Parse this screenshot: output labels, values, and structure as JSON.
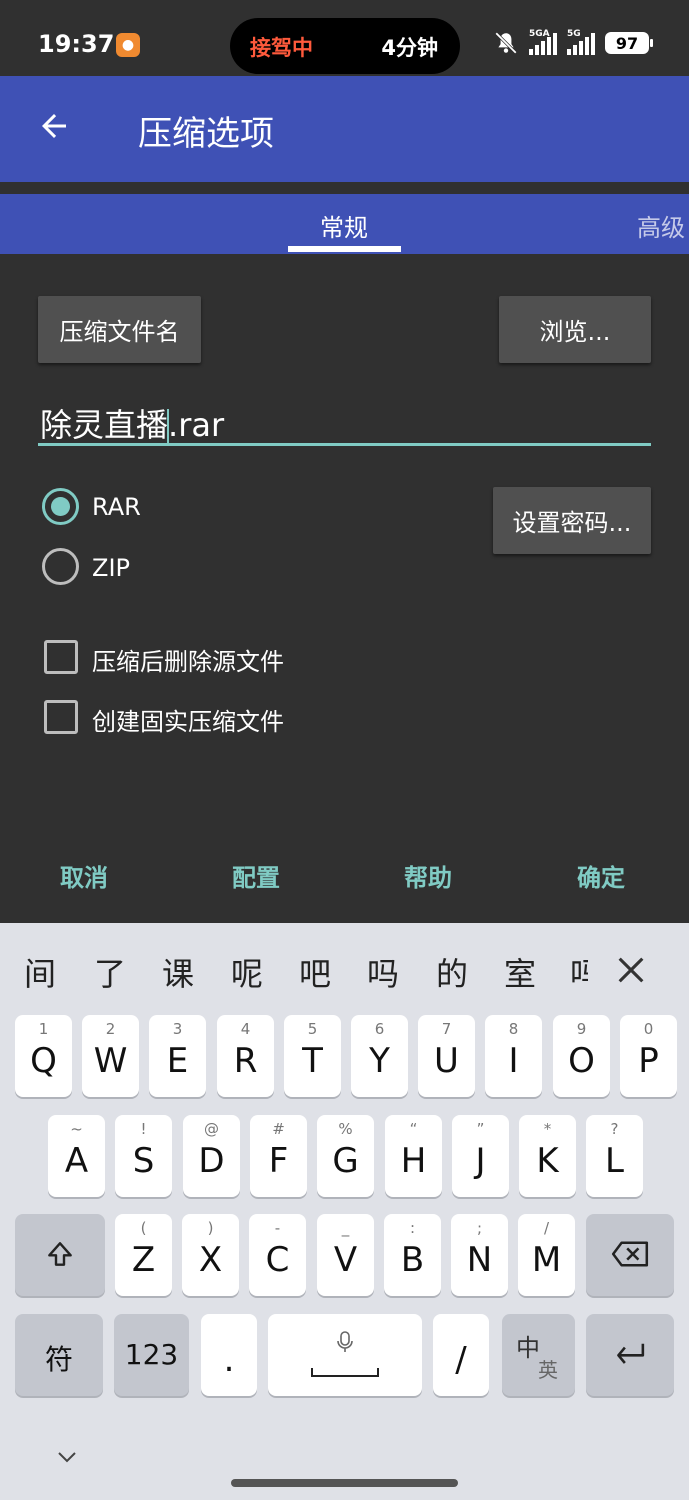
{
  "status_bar": {
    "time": "19:37",
    "app_icon": "app-icon",
    "island_left": "接驾中",
    "island_right": "4分钟",
    "net1": "5G",
    "net1_sub": "A",
    "net2": "5G",
    "battery": "97"
  },
  "app_bar": {
    "title": "压缩选项"
  },
  "tabs": {
    "general": "常规",
    "advanced": "高级"
  },
  "form": {
    "archive_name_button": "压缩文件名",
    "browse_button": "浏览...",
    "filename_before_caret": "除灵直播",
    "filename_after_caret": ".rar",
    "format_rar": "RAR",
    "format_zip": "ZIP",
    "format_selected": "RAR",
    "password_button": "设置密码...",
    "delete_after": "压缩后删除源文件",
    "solid_archive": "创建固实压缩文件"
  },
  "actions": {
    "cancel": "取消",
    "profiles": "配置",
    "help": "帮助",
    "ok": "确定"
  },
  "keyboard": {
    "candidates": [
      "间",
      "了",
      "课",
      "呢",
      "吧",
      "吗",
      "的",
      "室",
      "吗"
    ],
    "row1": [
      {
        "main": "Q",
        "sub": "1"
      },
      {
        "main": "W",
        "sub": "2"
      },
      {
        "main": "E",
        "sub": "3"
      },
      {
        "main": "R",
        "sub": "4"
      },
      {
        "main": "T",
        "sub": "5"
      },
      {
        "main": "Y",
        "sub": "6"
      },
      {
        "main": "U",
        "sub": "7"
      },
      {
        "main": "I",
        "sub": "8"
      },
      {
        "main": "O",
        "sub": "9"
      },
      {
        "main": "P",
        "sub": "0"
      }
    ],
    "row2": [
      {
        "main": "A",
        "sub": "~"
      },
      {
        "main": "S",
        "sub": "!"
      },
      {
        "main": "D",
        "sub": "@"
      },
      {
        "main": "F",
        "sub": "#"
      },
      {
        "main": "G",
        "sub": "%"
      },
      {
        "main": "H",
        "sub": "“"
      },
      {
        "main": "J",
        "sub": "”"
      },
      {
        "main": "K",
        "sub": "*"
      },
      {
        "main": "L",
        "sub": "?"
      }
    ],
    "row3": [
      {
        "main": "Z",
        "sub": "("
      },
      {
        "main": "X",
        "sub": ")"
      },
      {
        "main": "C",
        "sub": "-"
      },
      {
        "main": "V",
        "sub": "_"
      },
      {
        "main": "B",
        "sub": ":"
      },
      {
        "main": "N",
        "sub": ";"
      },
      {
        "main": "M",
        "sub": "/"
      }
    ],
    "symbols": "符",
    "numbers": "123",
    "period": ".",
    "slash": "/",
    "lang_main": "中",
    "lang_sub": "英"
  }
}
